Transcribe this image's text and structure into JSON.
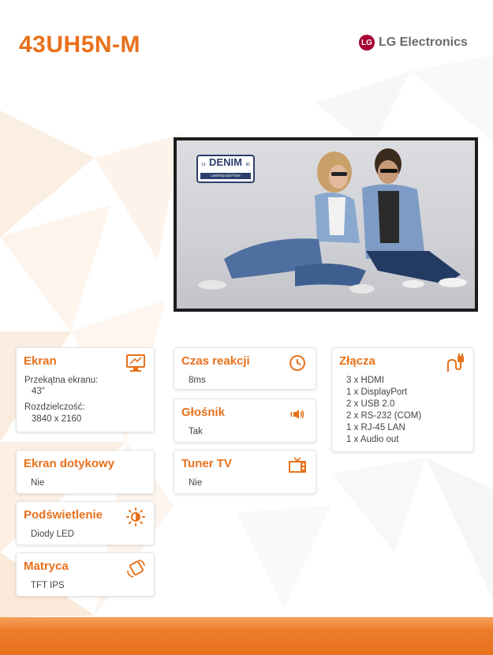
{
  "header": {
    "model": "43UH5N-M",
    "brand_mark": "LG",
    "brand": "LG Electronics"
  },
  "image": {
    "badge_word": "DENIM",
    "badge_year_left": "19",
    "badge_year_right": "86",
    "badge_sub": "LIMITED EDITION"
  },
  "colors": {
    "accent": "#e8711c",
    "brand": "#a50034",
    "text": "#444444"
  },
  "cards": {
    "ekran": {
      "title": "Ekran",
      "icon": "monitor-icon",
      "diag_label": "Przekątna ekranu:",
      "diag_value": "43\"",
      "res_label": "Rozdzielczość:",
      "res_value": "3840 x 2160"
    },
    "czas": {
      "title": "Czas reakcji",
      "icon": "clock-icon",
      "value": "8ms"
    },
    "zlacza": {
      "title": "Złącza",
      "icon": "plug-icon",
      "items": [
        "3 x HDMI",
        "1 x DisplayPort",
        "2 x USB 2.0",
        "2 x RS-232 (COM)",
        "1 x RJ-45 LAN",
        "1 x Audio out"
      ]
    },
    "glosnik": {
      "title": "Głośnik",
      "icon": "speaker-icon",
      "value": "Tak"
    },
    "dotykowy": {
      "title": "Ekran dotykowy",
      "value": "Nie"
    },
    "tuner": {
      "title": "Tuner TV",
      "icon": "tv-icon",
      "value": "Nie"
    },
    "podswietlenie": {
      "title": "Podświetlenie",
      "icon": "sun-icon",
      "value": "Diody LED"
    },
    "matryca": {
      "title": "Matryca",
      "icon": "panel-rotate-icon",
      "value": "TFT IPS"
    }
  }
}
